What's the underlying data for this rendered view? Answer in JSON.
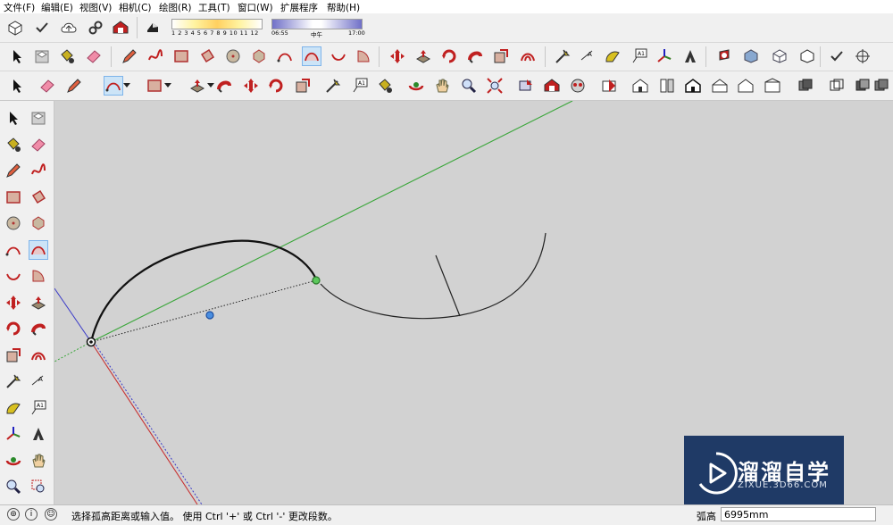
{
  "menu": [
    "文件(F)",
    "编辑(E)",
    "视图(V)",
    "相机(C)",
    "绘图(R)",
    "工具(T)",
    "窗口(W)",
    "扩展程序",
    "帮助(H)"
  ],
  "shadow": {
    "month_scale": "1 2 3 4 5 6 7 8 9 10 11 12",
    "time_start": "06:55",
    "time_mid": "中午",
    "time_end": "17:00"
  },
  "status": {
    "message": "选择孤高距离或输入值。 使用 Ctrl '+' 或 Ctrl '-' 更改段数。",
    "measure_label": "弧高",
    "measure_value": "6995mm"
  },
  "watermark": {
    "brand": "溜溜自学",
    "url": "ZIXUE.3D66.COM"
  },
  "colors": {
    "accent_active": "#cce4f7",
    "axis_green": "#3aa63a",
    "axis_red": "#c83232",
    "axis_blue": "#3a3ac8",
    "viewport_bg": "#d2d2d2",
    "watermark_bg": "#1f3a66"
  },
  "toolbars": {
    "row1": [
      "component-icon",
      "check-icon",
      "cloud-upload-icon",
      "link-icon",
      "warehouse-icon",
      "eraser-icon"
    ],
    "row2": [
      "select-icon",
      "make-component-icon",
      "paint-bucket-icon",
      "eraser-icon",
      "pencil-icon",
      "freehand-icon",
      "rectangle-icon",
      "rotated-rectangle-icon",
      "circle-icon",
      "polygon-icon",
      "arc-icon",
      "arc-2point-icon",
      "arc-3point-icon",
      "pie-icon",
      "move-icon",
      "push-pull-icon",
      "rotate-icon",
      "follow-me-icon",
      "scale-icon",
      "offset-icon",
      "tape-measure-icon",
      "dimension-icon",
      "protractor-icon",
      "text-icon",
      "axes-icon",
      "3d-text-icon",
      "section-plane-icon",
      "xray-icon",
      "wireframe-icon",
      "hidden-line-icon",
      "check-icon",
      "axis-icon"
    ],
    "row3": [
      "select-icon",
      "eraser-icon",
      "pencil-icon",
      "arc-icon",
      "rectangle-icon",
      "push-pull-icon",
      "follow-me-icon",
      "move-icon",
      "rotate-icon",
      "scale-icon",
      "tape-measure-icon",
      "text-icon",
      "paint-bucket-icon",
      "orbit-icon",
      "pan-icon",
      "zoom-icon",
      "zoom-extents-icon",
      "previous-view-icon",
      "warehouse-icon",
      "share-icon",
      "extension-icon",
      "iso-view-icon",
      "top-view-icon",
      "front-view-icon",
      "right-view-icon",
      "back-view-icon",
      "left-view-icon",
      "group-icon",
      "outer-shell-icon",
      "intersect-icon",
      "union-icon",
      "subtract-icon"
    ],
    "left": [
      "select-icon",
      "make-component-icon",
      "paint-bucket-icon",
      "eraser-icon",
      "pencil-icon",
      "freehand-icon",
      "rectangle-icon",
      "rotated-rectangle-icon",
      "circle-icon",
      "polygon-icon",
      "arc-icon",
      "arc-2point-icon",
      "arc-3point-icon",
      "pie-icon",
      "move-icon",
      "push-pull-icon",
      "rotate-icon",
      "follow-me-icon",
      "scale-icon",
      "offset-icon",
      "tape-measure-icon",
      "dimension-icon",
      "protractor-icon",
      "text-icon",
      "axes-icon",
      "3d-text-icon",
      "orbit-icon",
      "pan-icon",
      "zoom-icon",
      "zoom-window-icon"
    ]
  }
}
